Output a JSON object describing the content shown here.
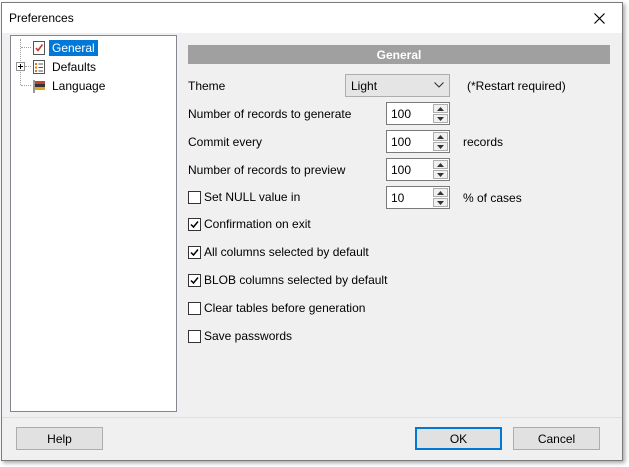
{
  "window": {
    "title": "Preferences"
  },
  "tree": {
    "items": [
      {
        "label": "General",
        "selected": true
      },
      {
        "label": "Defaults",
        "selected": false
      },
      {
        "label": "Language",
        "selected": false
      }
    ]
  },
  "panel": {
    "header": "General",
    "theme": {
      "label": "Theme",
      "value": "Light",
      "note": "(*Restart required)"
    },
    "records_generate": {
      "label": "Number of records to generate",
      "value": "100"
    },
    "commit_every": {
      "label": "Commit every",
      "value": "100",
      "unit": "records"
    },
    "records_preview": {
      "label": "Number of records to preview",
      "value": "100"
    },
    "set_null": {
      "label": "Set NULL value in",
      "value": "10",
      "unit": "% of cases",
      "checked": false
    },
    "confirm_exit": {
      "label": "Confirmation on exit",
      "checked": true
    },
    "all_columns": {
      "label": "All columns selected by default",
      "checked": true
    },
    "blob_columns": {
      "label": "BLOB columns selected by default",
      "checked": true
    },
    "clear_tables": {
      "label": "Clear tables before generation",
      "checked": false
    },
    "save_passwords": {
      "label": "Save passwords",
      "checked": false
    }
  },
  "buttons": {
    "help": "Help",
    "ok": "OK",
    "cancel": "Cancel"
  },
  "colors": {
    "selection": "#0078d7",
    "header_bg": "#a0a0a0",
    "dialog_bg": "#f0f0f0"
  }
}
